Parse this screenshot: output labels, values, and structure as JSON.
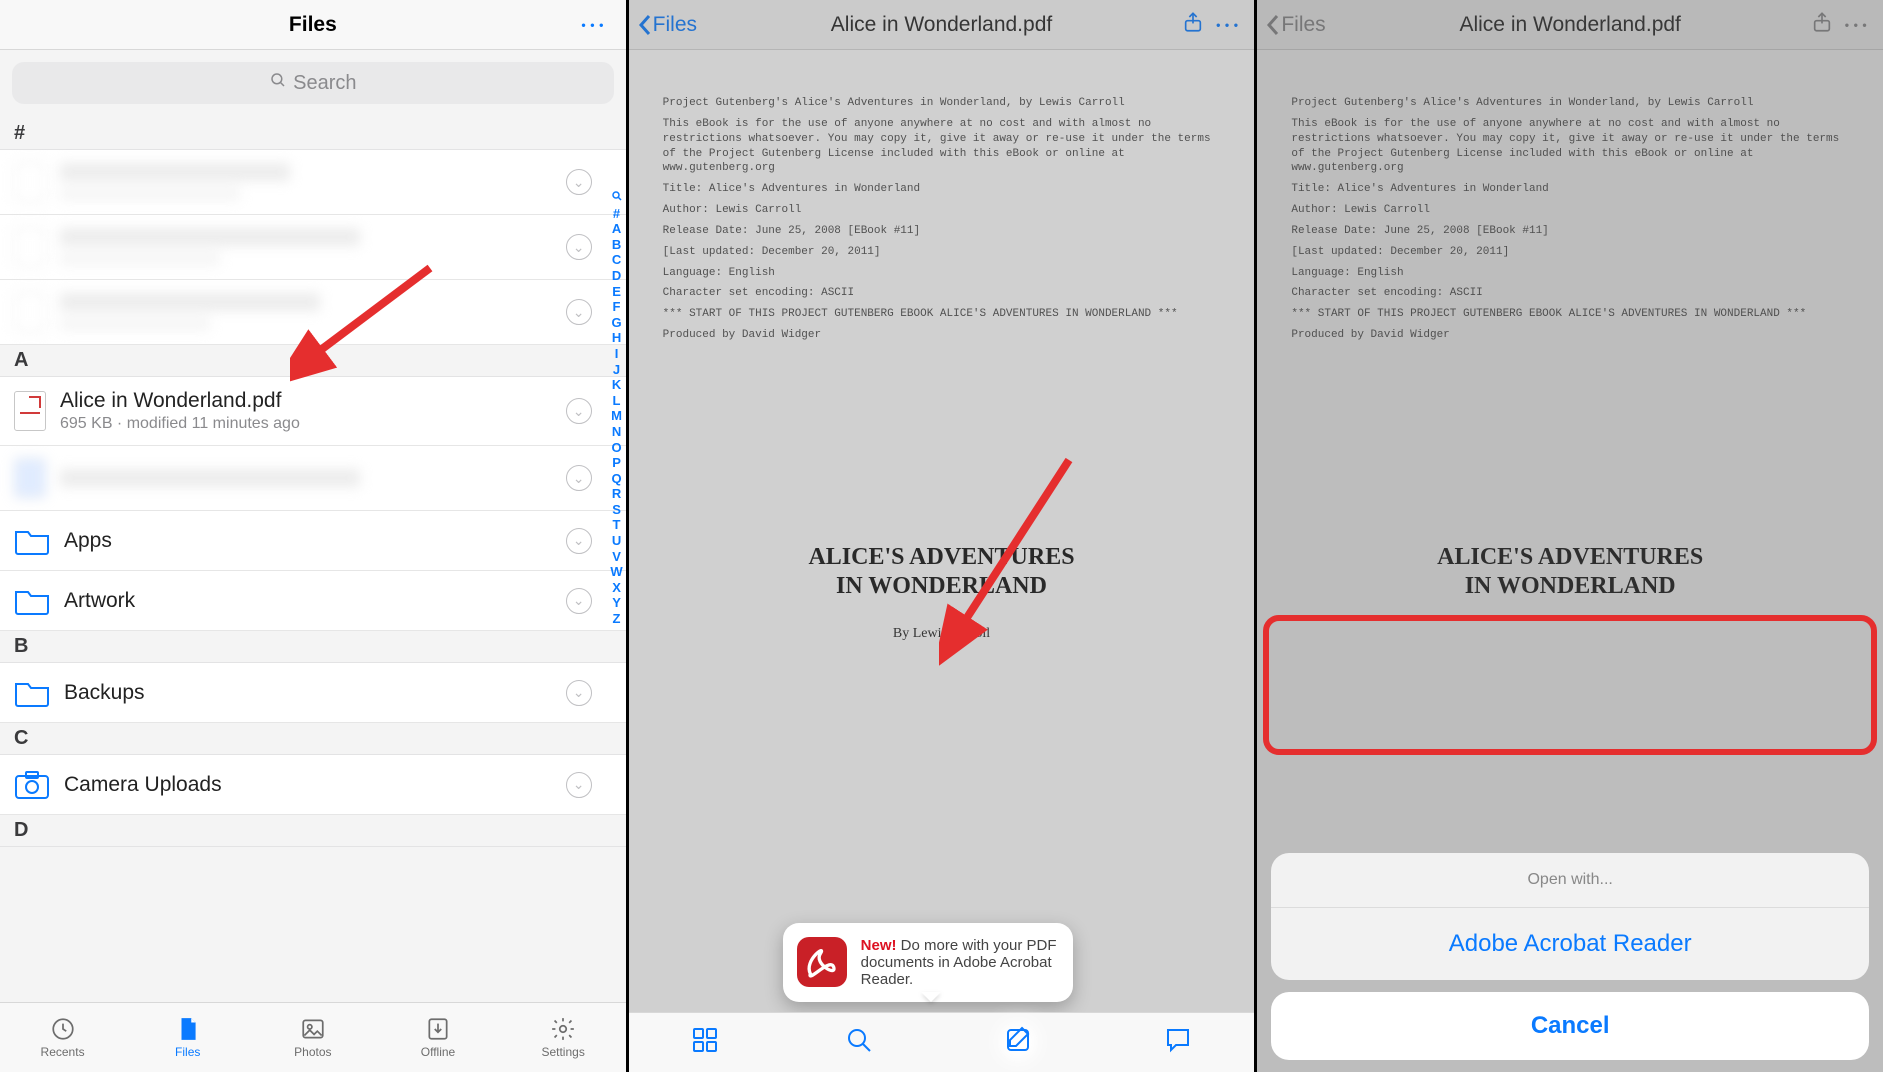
{
  "screen1": {
    "header": {
      "title": "Files"
    },
    "search_placeholder": "Search",
    "sections": {
      "hash": "#",
      "a": "A",
      "b": "B",
      "c": "C",
      "d": "D"
    },
    "alice": {
      "title": "Alice in Wonderland.pdf",
      "subtitle": "695 KB · modified 11 minutes ago"
    },
    "apps": {
      "title": "Apps"
    },
    "artwork": {
      "title": "Artwork"
    },
    "backups": {
      "title": "Backups"
    },
    "camera": {
      "title": "Camera Uploads"
    },
    "index": [
      "#",
      "A",
      "B",
      "C",
      "D",
      "E",
      "F",
      "G",
      "H",
      "I",
      "J",
      "K",
      "L",
      "M",
      "N",
      "O",
      "P",
      "Q",
      "R",
      "S",
      "T",
      "U",
      "V",
      "W",
      "X",
      "Y",
      "Z"
    ],
    "tabs": {
      "recents": "Recents",
      "files": "Files",
      "photos": "Photos",
      "offline": "Offline",
      "settings": "Settings"
    }
  },
  "screen2": {
    "back": "Files",
    "title": "Alice in Wonderland.pdf",
    "doc": {
      "p1": "Project Gutenberg's Alice's Adventures in Wonderland, by Lewis Carroll",
      "p2": "This eBook is for the use of anyone anywhere at no cost and with almost no restrictions whatsoever. You may copy it, give it away or re-use it under the terms of the Project Gutenberg License included with this eBook or online at www.gutenberg.org",
      "p3": "Title: Alice's Adventures in Wonderland",
      "p4": "Author: Lewis Carroll",
      "p5": "Release Date: June 25, 2008 [EBook #11]",
      "p6": "[Last updated: December 20, 2011]",
      "p7": "Language: English",
      "p8": "Character set encoding: ASCII",
      "p9": "*** START OF THIS PROJECT GUTENBERG EBOOK ALICE'S ADVENTURES IN WONDERLAND ***",
      "p10": "Produced by David Widger",
      "book1": "ALICE'S ADVENTURES",
      "book2": "IN WONDERLAND",
      "byline": "By Lewis Carroll"
    },
    "popup_new": "New!",
    "popup_text": " Do more with your PDF documents in Adobe Acrobat Reader."
  },
  "screen3": {
    "back": "Files",
    "title": "Alice in Wonderland.pdf",
    "sheet_title": "Open with...",
    "sheet_option": "Adobe Acrobat Reader",
    "sheet_cancel": "Cancel"
  }
}
